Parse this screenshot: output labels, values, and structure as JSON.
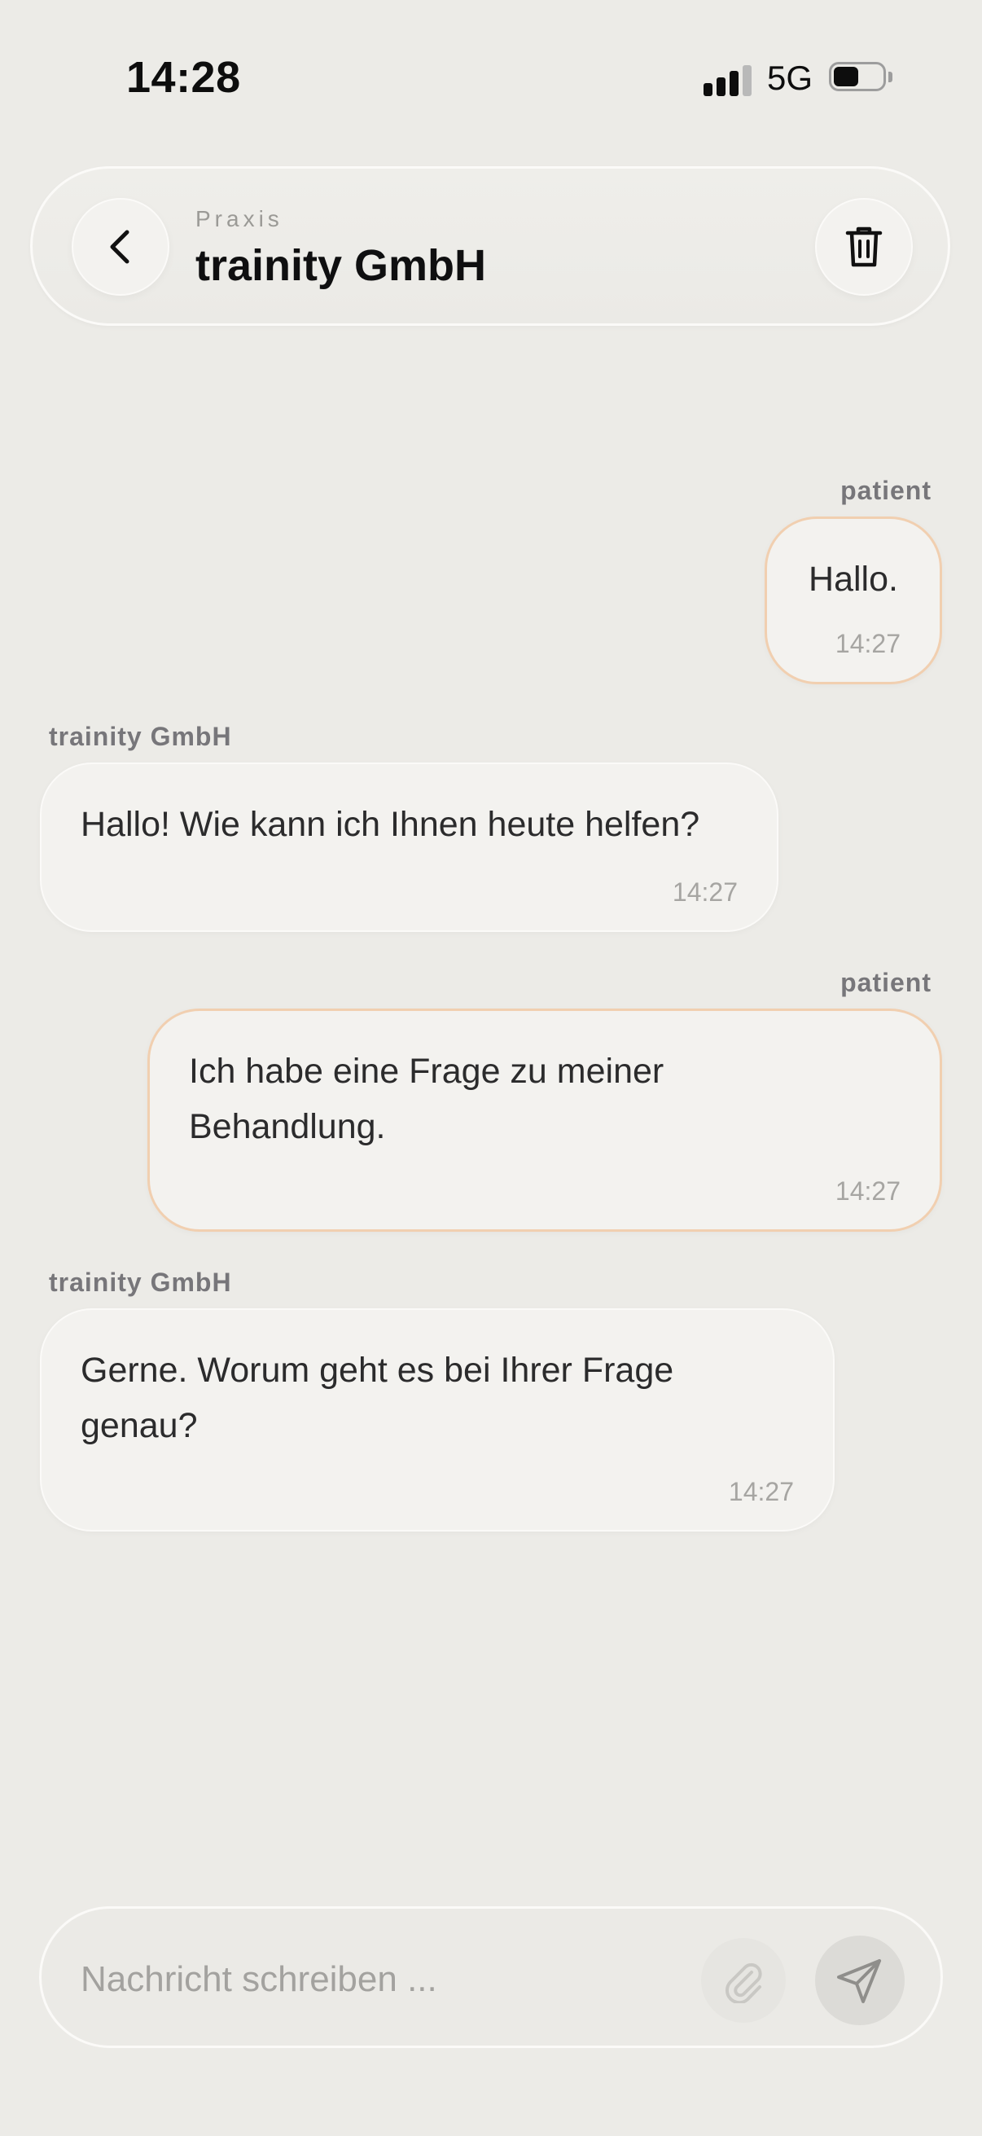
{
  "status_bar": {
    "time": "14:28",
    "network": "5G",
    "signal_bars_active": 3,
    "signal_bars_total": 4,
    "battery_level": 0.45
  },
  "header": {
    "eyebrow": "Praxis",
    "title": "trainity GmbH",
    "back_icon": "chevron-left-icon",
    "delete_icon": "trash-icon"
  },
  "messages": [
    {
      "sender": "patient",
      "text": "Hallo.",
      "time": "14:27",
      "direction": "outgoing"
    },
    {
      "sender": "trainity GmbH",
      "text": "Hallo! Wie kann ich Ihnen heute helfen?",
      "time": "14:27",
      "direction": "incoming"
    },
    {
      "sender": "patient",
      "text": "Ich habe eine Frage zu meiner Behandlung.",
      "time": "14:27",
      "direction": "outgoing"
    },
    {
      "sender": "trainity GmbH",
      "text": "Gerne. Worum geht es bei Ihrer Frage genau?",
      "time": "14:27",
      "direction": "incoming"
    }
  ],
  "composer": {
    "placeholder": "Nachricht schreiben ...",
    "value": "",
    "attach_icon": "paperclip-icon",
    "send_icon": "send-icon"
  },
  "colors": {
    "background": "#ecebe7",
    "bubble": "#f3f2ef",
    "outgoing_border": "#f1cfb0",
    "sender_label": "#77767a",
    "timestamp": "#a6a5a2"
  }
}
